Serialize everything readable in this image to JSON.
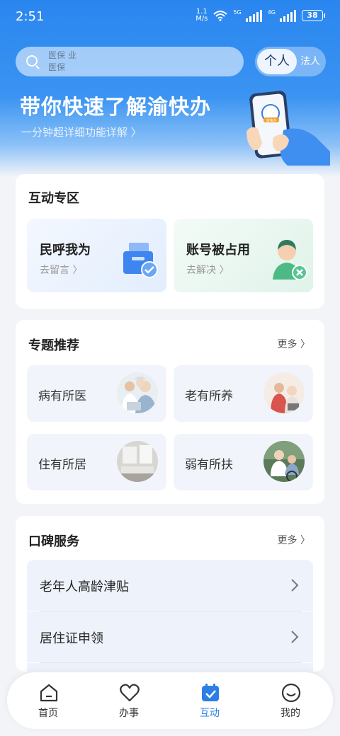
{
  "status": {
    "time": "2:51",
    "speed_top": "1.1",
    "speed_unit": "M/s",
    "sig1": "5G",
    "sig2": "4G",
    "battery": "38"
  },
  "search": {
    "placeholder_line1": "医保 业",
    "placeholder_line2": "医保"
  },
  "toggle": {
    "active": "个人",
    "inactive": "法人"
  },
  "hero": {
    "title": "带你快速了解渝快办",
    "subtitle": "一分钟超详细功能详解 〉",
    "phone_badge": "渝快办"
  },
  "interact": {
    "title": "互动专区",
    "tiles": [
      {
        "title": "民呼我为",
        "sub": "去留言 〉",
        "icon": "inbox-check-icon"
      },
      {
        "title": "账号被占用",
        "sub": "去解决 〉",
        "icon": "user-x-icon"
      }
    ]
  },
  "topics": {
    "title": "专题推荐",
    "more": "更多",
    "items": [
      {
        "label": "病有所医",
        "image": "medical-photo"
      },
      {
        "label": "老有所养",
        "image": "elderly-care-photo"
      },
      {
        "label": "住有所居",
        "image": "home-photo"
      },
      {
        "label": "弱有所扶",
        "image": "wheelchair-photo"
      }
    ]
  },
  "services": {
    "title": "口碑服务",
    "more": "更多",
    "items": [
      "老年人高龄津贴",
      "居住证申领"
    ]
  },
  "tabs": [
    {
      "label": "首页",
      "icon": "home-icon"
    },
    {
      "label": "办事",
      "icon": "heart-icon"
    },
    {
      "label": "互动",
      "icon": "calendar-check-icon",
      "active": true
    },
    {
      "label": "我的",
      "icon": "smile-icon"
    }
  ],
  "colors": {
    "primary": "#2a86ef",
    "active_tab": "#2d7fe6"
  }
}
